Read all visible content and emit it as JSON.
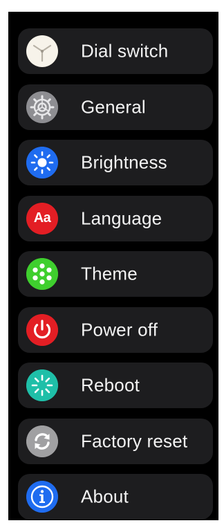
{
  "menu": {
    "items": [
      {
        "label": "Dial switch",
        "icon": "clock-face-icon",
        "icon_color": "#f5f0e6"
      },
      {
        "label": "General",
        "icon": "gear-icon",
        "icon_color": "#8a8a8e"
      },
      {
        "label": "Brightness",
        "icon": "sun-icon",
        "icon_color": "#1f6cf0"
      },
      {
        "label": "Language",
        "icon": "language-icon",
        "icon_color": "#e31e24",
        "icon_text": "Aa"
      },
      {
        "label": "Theme",
        "icon": "theme-icon",
        "icon_color": "#3fcf2e"
      },
      {
        "label": "Power off",
        "icon": "power-icon",
        "icon_color": "#e31e24"
      },
      {
        "label": "Reboot",
        "icon": "reboot-icon",
        "icon_color": "#1fbfa8"
      },
      {
        "label": "Factory reset",
        "icon": "factory-reset-icon",
        "icon_color": "#9a9a9c"
      },
      {
        "label": "About",
        "icon": "info-icon",
        "icon_color": "#1f6cf0"
      }
    ]
  }
}
